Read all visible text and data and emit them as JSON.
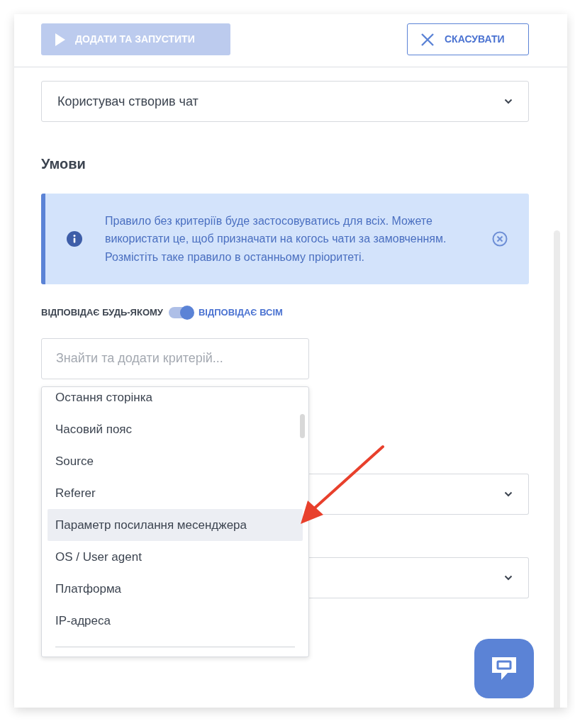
{
  "header": {
    "buttons": [
      {
        "kind": "run",
        "label": "ДОДАТИ ТА ЗАПУСТИТИ",
        "disabled": true
      },
      {
        "kind": "cancel",
        "label": "СКАСУВАТИ",
        "disabled": false
      }
    ]
  },
  "trigger_select": {
    "value": "Користувач створив чат"
  },
  "conditions": {
    "title": "Умови",
    "alert": {
      "text": "Правило без критеріїв буде застосовуватись для всіх. Можете використати це, щоб призначати на когось чати за замовченням. Розмістіть таке правило в останньому пріоритеті."
    },
    "match": {
      "left_label": "ВІДПОВІДАЄ БУДЬ-ЯКОМУ",
      "right_label": "ВІДПОВІДАЄ ВСІМ",
      "on": true
    },
    "search": {
      "placeholder": "Знайти та додати критерій..."
    },
    "dropdown": {
      "items": [
        {
          "label": "Остання сторінка",
          "selected": false
        },
        {
          "label": "Часовий пояс",
          "selected": false
        },
        {
          "label": "Source",
          "selected": false
        },
        {
          "label": "Referer",
          "selected": false
        },
        {
          "label": "Параметр посилання месенджера",
          "selected": true
        },
        {
          "label": "OS / User agent",
          "selected": false
        },
        {
          "label": "Платформа",
          "selected": false
        },
        {
          "label": "IP-адреса",
          "selected": false
        }
      ]
    }
  },
  "annotation_arrow": true
}
